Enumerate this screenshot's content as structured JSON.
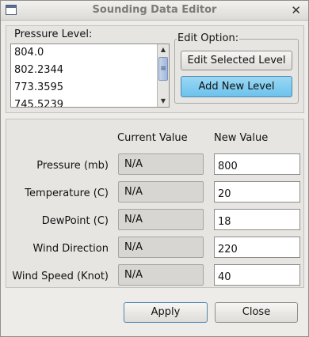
{
  "window": {
    "title": "Sounding Data Editor",
    "close_glyph": "✕"
  },
  "pressure_level": {
    "label": "Pressure Level:",
    "items": [
      "804.0",
      "802.2344",
      "773.3595",
      "745.5239"
    ]
  },
  "edit_option": {
    "label": "Edit Option:",
    "edit_selected_label": "Edit Selected Level",
    "add_new_label": "Add New Level"
  },
  "table": {
    "current_header": "Current Value",
    "new_header": "New Value",
    "rows": [
      {
        "label": "Pressure (mb)",
        "current": "N/A",
        "new": "800"
      },
      {
        "label": "Temperature (C)",
        "current": "N/A",
        "new": "20"
      },
      {
        "label": "DewPoint (C)",
        "current": "N/A",
        "new": "18"
      },
      {
        "label": "Wind Direction",
        "current": "N/A",
        "new": "220"
      },
      {
        "label": "Wind Speed (Knot)",
        "current": "N/A",
        "new": "40"
      }
    ]
  },
  "footer": {
    "apply_label": "Apply",
    "close_label": "Close"
  },
  "colors": {
    "active_button": "#6cc2ec",
    "focus_border": "#4d88b0"
  }
}
